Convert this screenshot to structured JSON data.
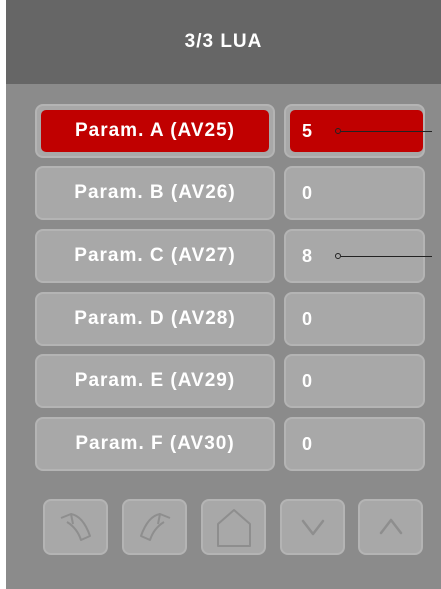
{
  "header": {
    "title": "3/3 LUA"
  },
  "params": [
    {
      "label": "Param. A (AV25)",
      "value": "5",
      "selected": true
    },
    {
      "label": "Param. B (AV26)",
      "value": "0",
      "selected": false
    },
    {
      "label": "Param. C (AV27)",
      "value": "8",
      "selected": false
    },
    {
      "label": "Param. D (AV28)",
      "value": "0",
      "selected": false
    },
    {
      "label": "Param. E (AV29)",
      "value": "0",
      "selected": false
    },
    {
      "label": "Param. F (AV30)",
      "value": "0",
      "selected": false
    }
  ],
  "nav": [
    {
      "name": "undo-icon"
    },
    {
      "name": "redo-icon"
    },
    {
      "name": "home-icon"
    },
    {
      "name": "chevron-down-icon"
    },
    {
      "name": "chevron-up-icon"
    }
  ],
  "colors": {
    "selected": "#c00000",
    "header": "#666666",
    "panel": "#8b8b8b",
    "button": "#a8a8a8"
  }
}
